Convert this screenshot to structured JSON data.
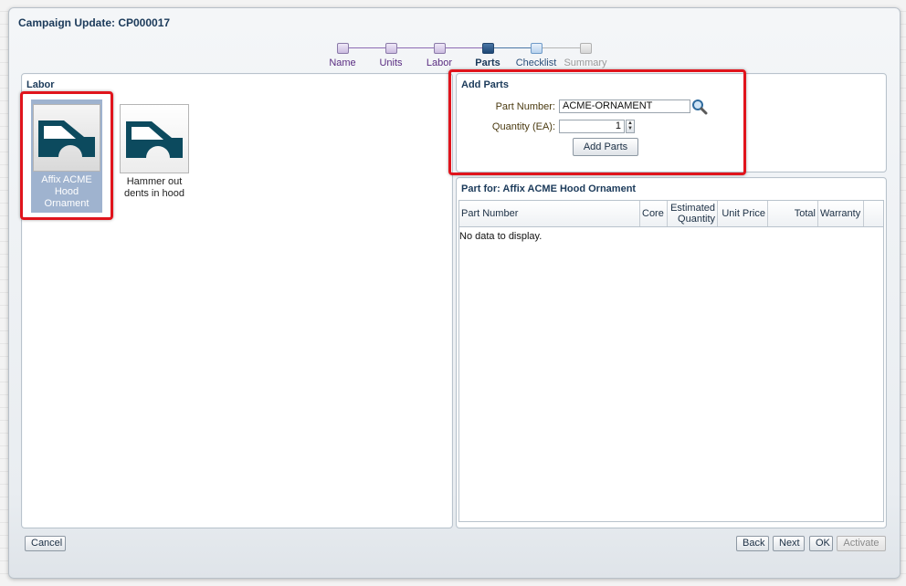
{
  "dialog": {
    "title": "Campaign Update: CP000017"
  },
  "train": {
    "stops": [
      {
        "label": "Name",
        "state": "visited"
      },
      {
        "label": "Units",
        "state": "visited"
      },
      {
        "label": "Labor",
        "state": "visited"
      },
      {
        "label": "Parts",
        "state": "current"
      },
      {
        "label": "Checklist",
        "state": "next"
      },
      {
        "label": "Summary",
        "state": "disabled"
      }
    ]
  },
  "labor": {
    "title": "Labor",
    "items": [
      {
        "label": "Affix ACME Hood Ornament",
        "icon": "car-hood-icon",
        "selected": true
      },
      {
        "label": "Hammer out dents in hood",
        "icon": "car-hood-icon",
        "selected": false
      }
    ]
  },
  "add_parts": {
    "title": "Add Parts",
    "part_number_label": "Part Number:",
    "part_number_value": "ACME-ORNAMENT",
    "quantity_label": "Quantity (EA):",
    "quantity_value": "1",
    "add_button": "Add Parts",
    "search_icon": "magnifier-icon"
  },
  "parts_table": {
    "title": "Part for: Affix ACME Hood Ornament",
    "columns": [
      "Part Number",
      "Core",
      "Estimated Quantity",
      "Unit Price",
      "Total",
      "Warranty"
    ],
    "empty_text": "No data to display."
  },
  "footer": {
    "cancel": "Cancel",
    "back": "Back",
    "next": "Next",
    "ok": "OK",
    "activate": "Activate"
  },
  "colors": {
    "highlight": "#e0141c",
    "selected_bg": "#9fb3cf",
    "heading": "#1b3a5a"
  }
}
